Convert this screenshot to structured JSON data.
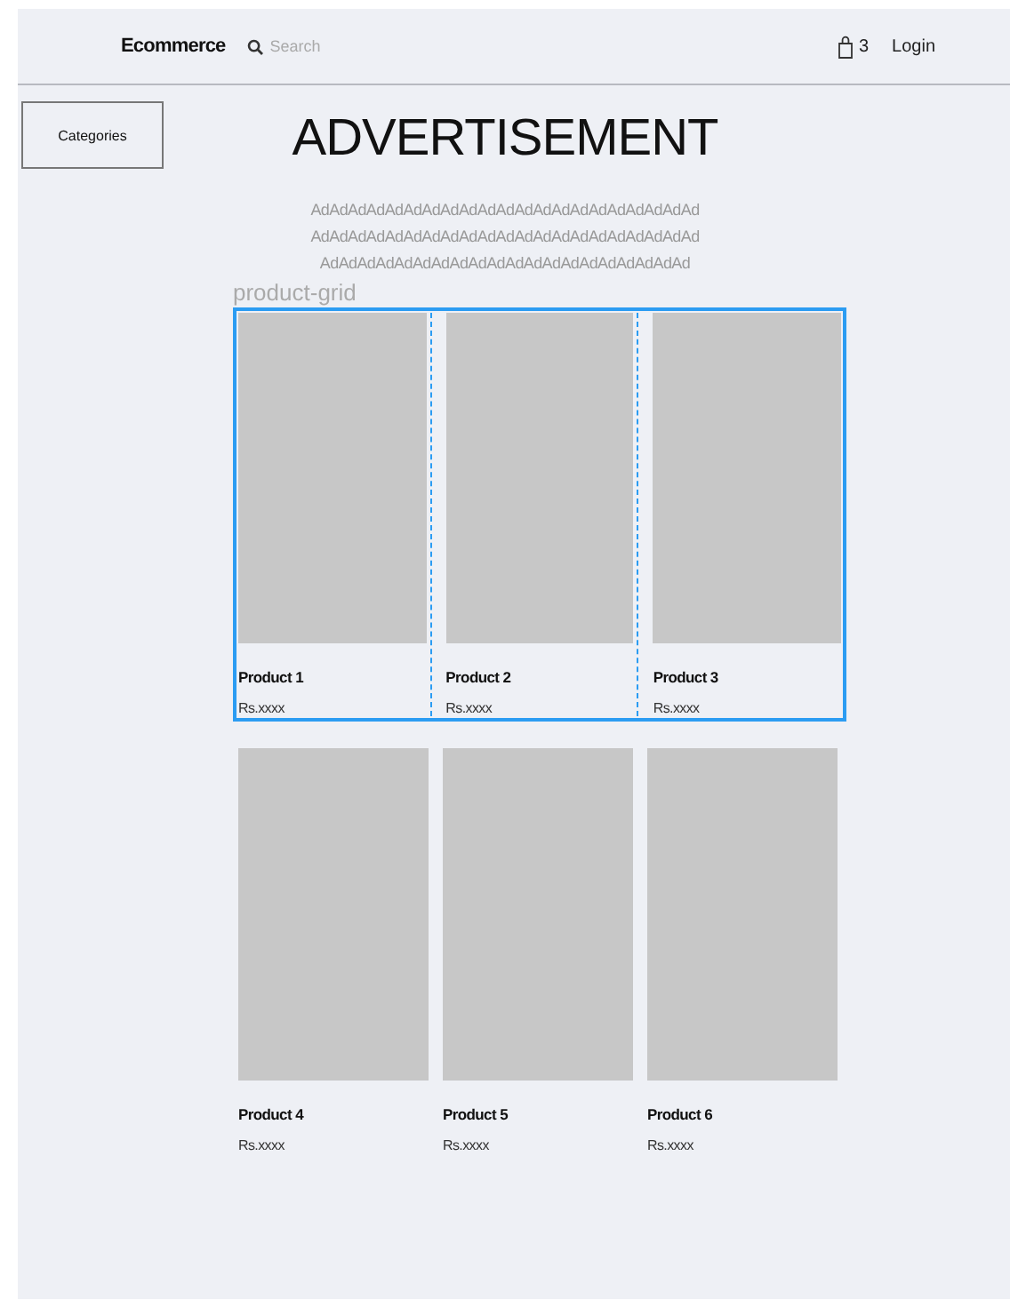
{
  "header": {
    "brand": "Ecommerce",
    "search": {
      "placeholder": "Search"
    },
    "cart_count": "3",
    "login": "Login"
  },
  "categories_button": "Categories",
  "advertisement": {
    "title": "ADVERTISEMENT",
    "lines": [
      "AdAdAdAdAdAdAdAdAdAdAdAdAdAdAdAdAdAdAdAdAd",
      "AdAdAdAdAdAdAdAdAdAdAdAdAdAdAdAdAdAdAdAdAd",
      "AdAdAdAdAdAdAdAdAdAdAdAdAdAdAdAdAdAdAdAd"
    ]
  },
  "grid_label": "product-grid",
  "product_rows": [
    {
      "selected": true,
      "products": [
        {
          "name": "Product 1",
          "price": "Rs.xxxx"
        },
        {
          "name": "Product 2",
          "price": "Rs.xxxx"
        },
        {
          "name": "Product 3",
          "price": "Rs.xxxx"
        }
      ]
    },
    {
      "selected": false,
      "products": [
        {
          "name": "Product 4",
          "price": "Rs.xxxx"
        },
        {
          "name": "Product 5",
          "price": "Rs.xxxx"
        },
        {
          "name": "Product 6",
          "price": "Rs.xxxx"
        }
      ]
    }
  ]
}
